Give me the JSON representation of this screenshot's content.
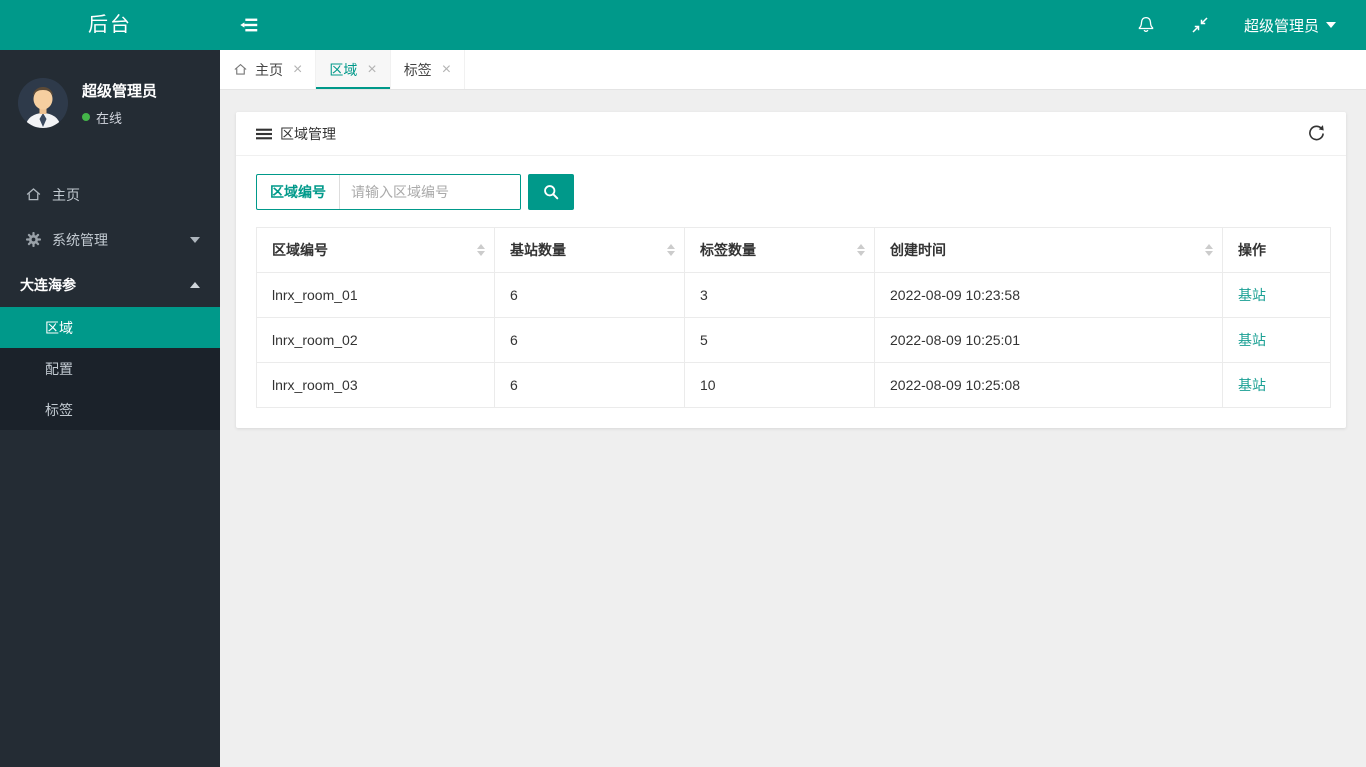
{
  "colors": {
    "teal": "#00998a",
    "sidebar_bg": "#242c34",
    "submenu_bg": "#1b222a",
    "body_bg": "#efefef",
    "link_teal": "#1aa094",
    "online_green": "#44b549"
  },
  "header": {
    "logo": "后台",
    "user_name": "超级管理员",
    "icons": [
      "menu-toggle-icon",
      "bell-icon",
      "screen-restore-icon",
      "caret-down-icon"
    ]
  },
  "sidebar": {
    "profile": {
      "name": "超级管理员",
      "status": "在线",
      "avatar": "user-avatar"
    },
    "menu": [
      {
        "label": "主页",
        "icon": "home-icon"
      },
      {
        "label": "系统管理",
        "icon": "gear-icon",
        "caret": "down"
      },
      {
        "label": "大连海参",
        "caret": "up"
      }
    ],
    "submenu": [
      {
        "label": "区域",
        "active": true
      },
      {
        "label": "配置"
      },
      {
        "label": "标签"
      }
    ]
  },
  "tabs": [
    {
      "label": "主页",
      "icon": "home-icon",
      "close": "×"
    },
    {
      "label": "区域",
      "close": "×",
      "active": true
    },
    {
      "label": "标签",
      "close": "×"
    }
  ],
  "panel": {
    "title": "区域管理",
    "title_icon": "list-icon",
    "refresh_icon": "refresh-icon",
    "search": {
      "label": "区域编号",
      "placeholder": "请输入区域编号",
      "button_icon": "search-icon"
    }
  },
  "table": {
    "headers": [
      "区域编号",
      "基站数量",
      "标签数量",
      "创建时间",
      "操作"
    ],
    "rows": [
      {
        "area_id": "lnrx_room_01",
        "stations": "6",
        "tags": "3",
        "created": "2022-08-09 10:23:58",
        "action": "基站"
      },
      {
        "area_id": "lnrx_room_02",
        "stations": "6",
        "tags": "5",
        "created": "2022-08-09 10:25:01",
        "action": "基站"
      },
      {
        "area_id": "lnrx_room_03",
        "stations": "6",
        "tags": "10",
        "created": "2022-08-09 10:25:08",
        "action": "基站"
      }
    ]
  }
}
